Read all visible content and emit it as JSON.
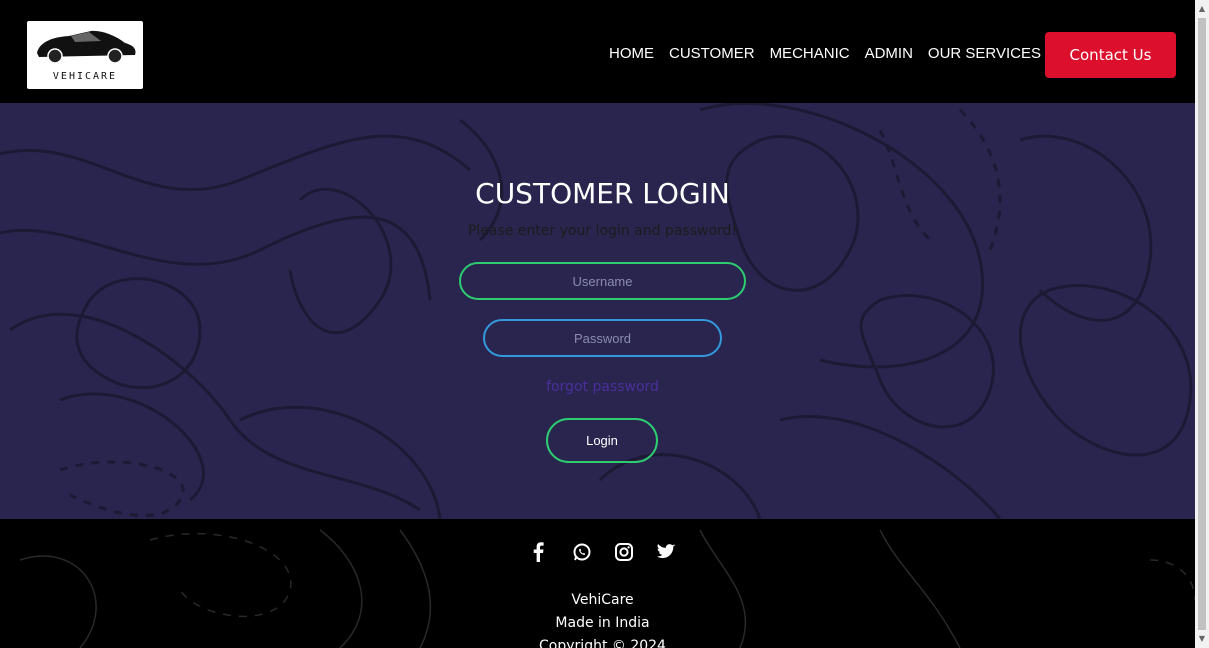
{
  "header": {
    "logo_text": "VEHICARE",
    "nav": [
      "HOME",
      "CUSTOMER",
      "MECHANIC",
      "ADMIN",
      "OUR SERVICES"
    ],
    "contact_label": "Contact Us"
  },
  "login": {
    "title": "CUSTOMER LOGIN",
    "subtitle": "Please enter your login and password!",
    "username_placeholder": "Username",
    "password_placeholder": "Password",
    "forgot_label": "forgot password",
    "login_label": "Login"
  },
  "footer": {
    "icons": [
      "facebook-icon",
      "whatsapp-icon",
      "instagram-icon",
      "twitter-icon"
    ],
    "line1": "VehiCare",
    "line2": "Made in India",
    "line3": "Copyright © 2024"
  },
  "colors": {
    "accent_red": "#dc0f2d",
    "main_bg": "#29254f",
    "green_border": "#2ecc71",
    "blue_border": "#3498db"
  }
}
